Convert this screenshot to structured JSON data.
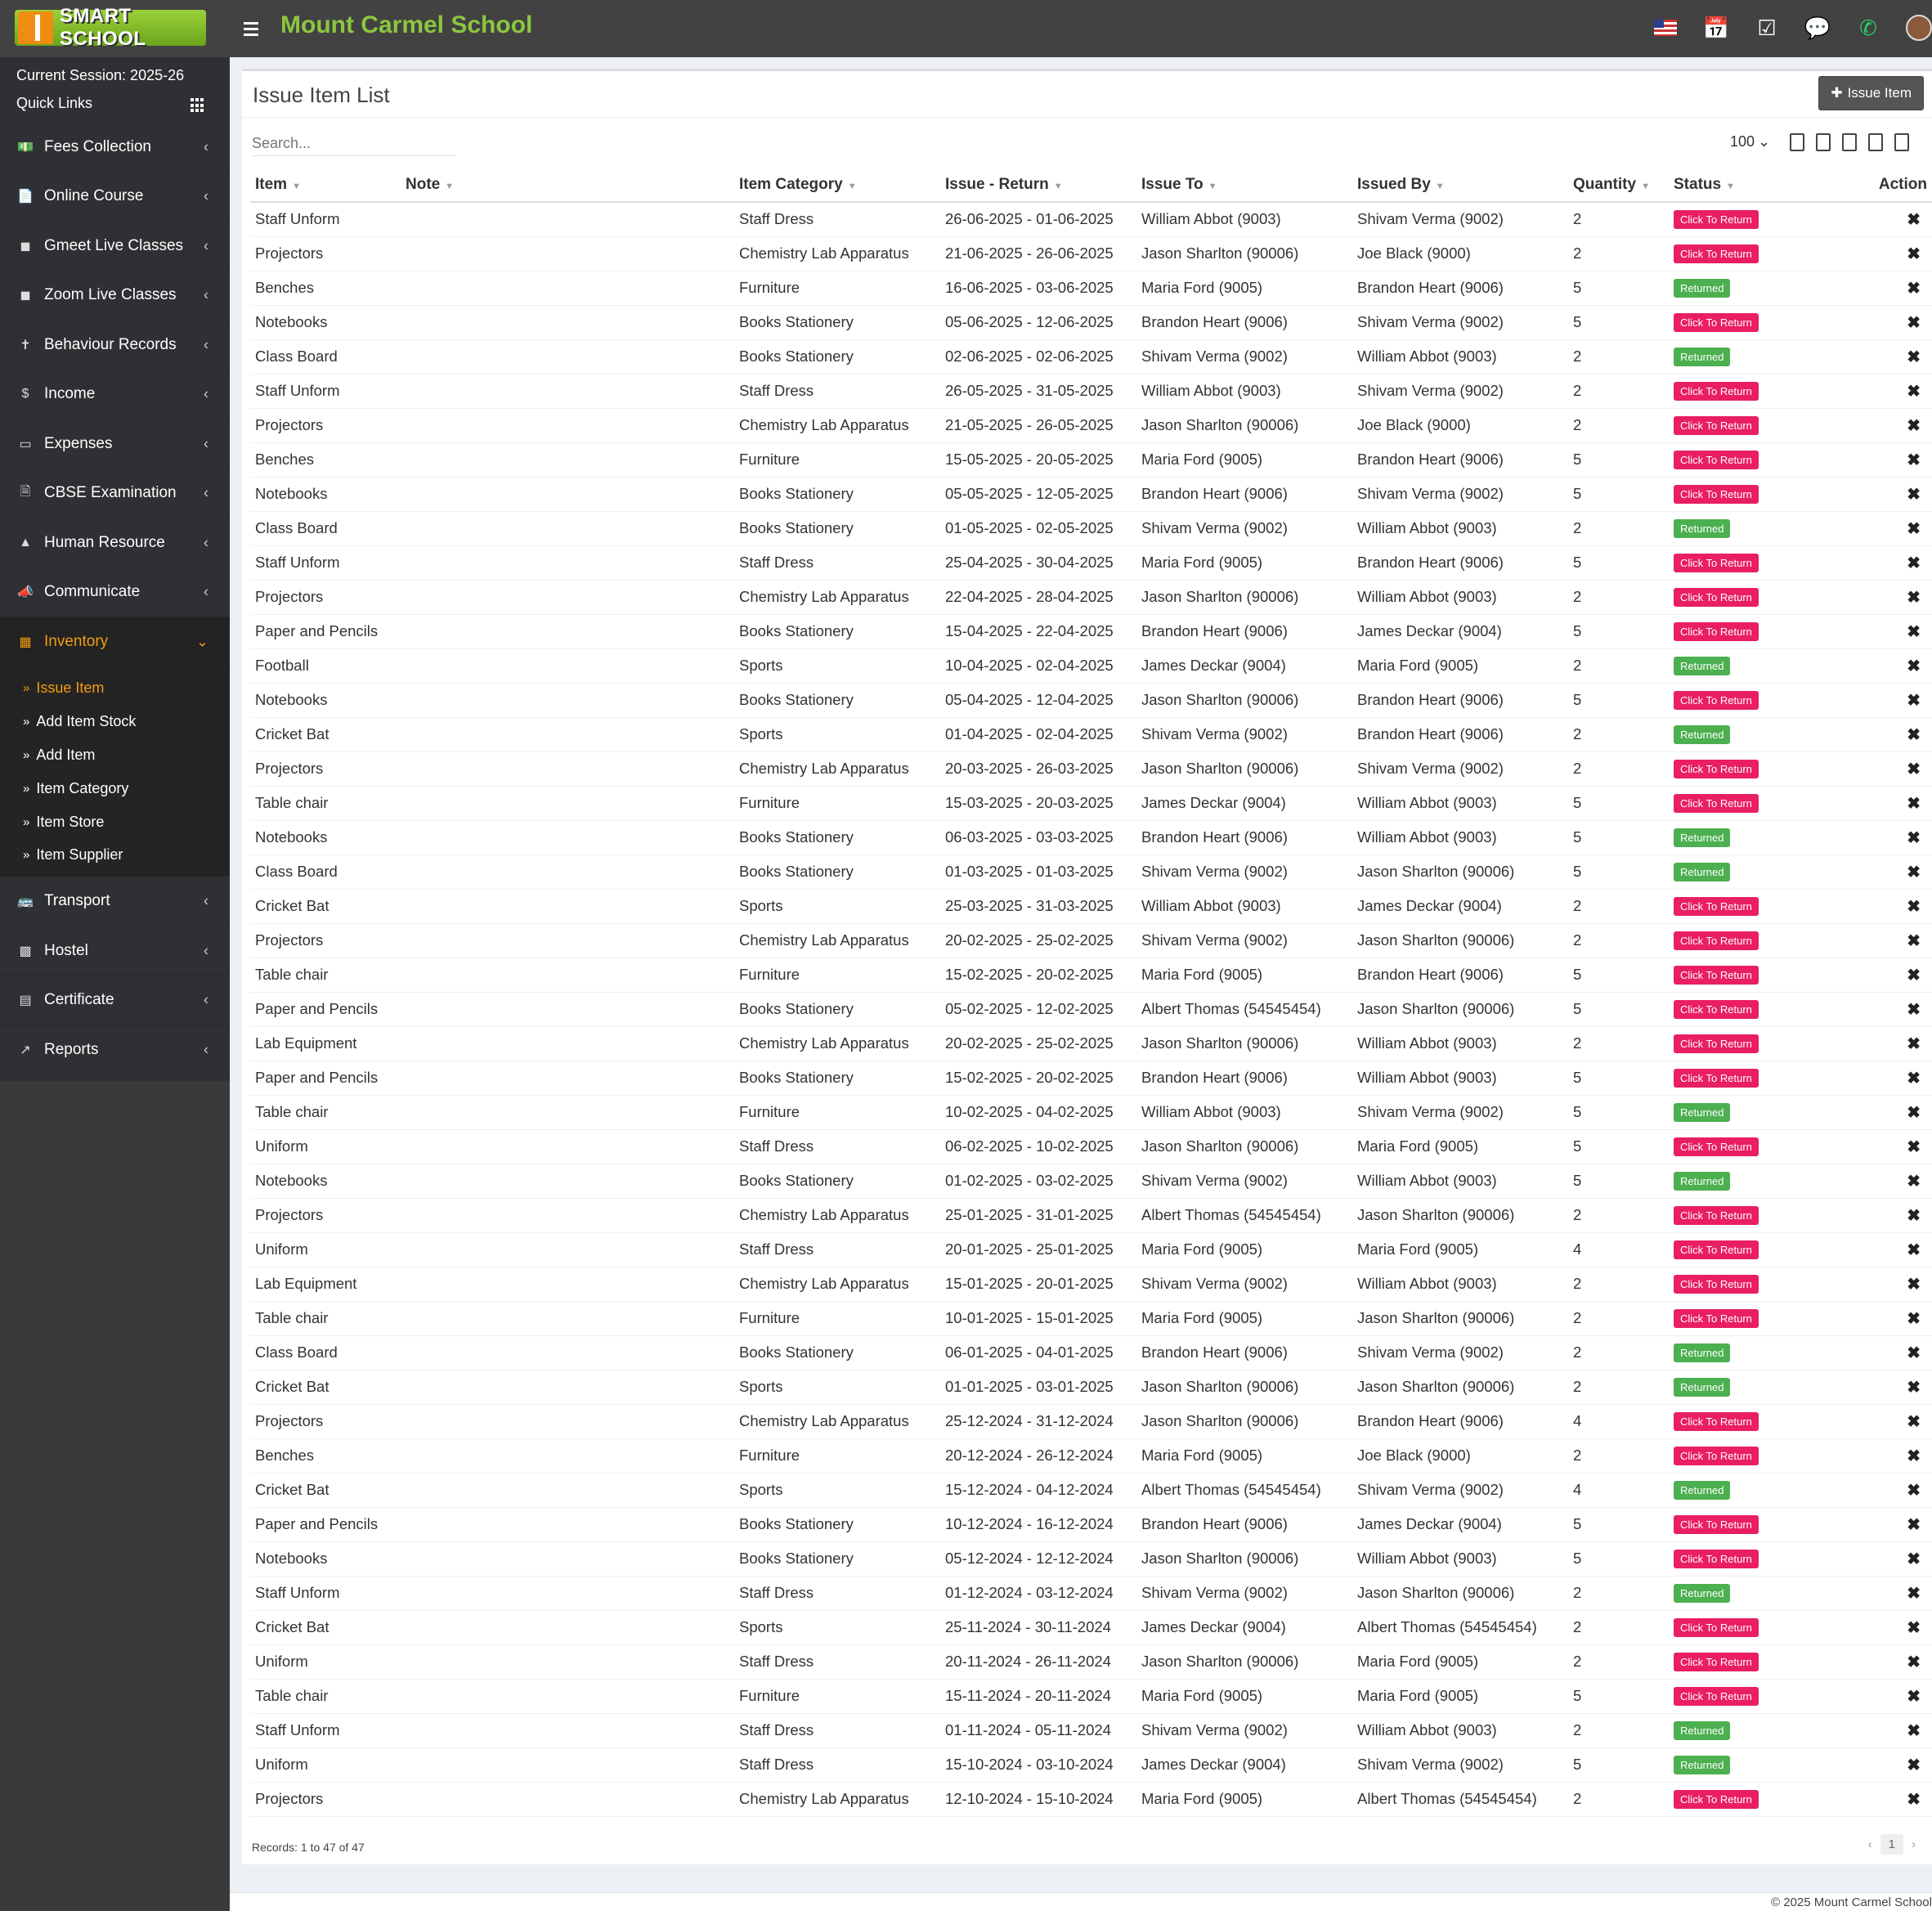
{
  "header": {
    "logo_text": "SMART SCHOOL",
    "school_name": "Mount Carmel School"
  },
  "sidebar": {
    "session": "Current Session: 2025-26",
    "quick_links": "Quick Links",
    "items": [
      {
        "label": "Fees Collection",
        "icon": "money-icon"
      },
      {
        "label": "Online Course",
        "icon": "file-icon"
      },
      {
        "label": "Gmeet Live Classes",
        "icon": "video-icon"
      },
      {
        "label": "Zoom Live Classes",
        "icon": "video-icon"
      },
      {
        "label": "Behaviour Records",
        "icon": "signpost-icon"
      },
      {
        "label": "Income",
        "icon": "dollar-icon"
      },
      {
        "label": "Expenses",
        "icon": "credit-card-icon"
      },
      {
        "label": "CBSE Examination",
        "icon": "document-icon"
      },
      {
        "label": "Human Resource",
        "icon": "sitemap-icon"
      },
      {
        "label": "Communicate",
        "icon": "bullhorn-icon"
      },
      {
        "label": "Inventory",
        "icon": "inventory-icon"
      }
    ],
    "inventory_sub": [
      "Issue Item",
      "Add Item Stock",
      "Add Item",
      "Item Category",
      "Item Store",
      "Item Supplier"
    ],
    "items_after": [
      {
        "label": "Transport",
        "icon": "bus-icon"
      },
      {
        "label": "Hostel",
        "icon": "building-icon"
      },
      {
        "label": "Certificate",
        "icon": "certificate-icon"
      },
      {
        "label": "Reports",
        "icon": "line-chart-icon"
      }
    ]
  },
  "main": {
    "title": "Issue Item List",
    "issue_button": "Issue Item",
    "search_placeholder": "Search...",
    "page_size": "100",
    "columns": [
      "Item",
      "Note",
      "Item Category",
      "Issue - Return",
      "Issue To",
      "Issued By",
      "Quantity",
      "Status",
      "Action"
    ],
    "rows": [
      [
        "Staff Unform",
        "",
        "Staff Dress",
        "26-06-2025 - 01-06-2025",
        "William Abbot (9003)",
        "Shivam Verma (9002)",
        "2",
        "Click To Return"
      ],
      [
        "Projectors",
        "",
        "Chemistry Lab Apparatus",
        "21-06-2025 - 26-06-2025",
        "Jason Sharlton (90006)",
        "Joe Black (9000)",
        "2",
        "Click To Return"
      ],
      [
        "Benches",
        "",
        "Furniture",
        "16-06-2025 - 03-06-2025",
        "Maria Ford (9005)",
        "Brandon Heart (9006)",
        "5",
        "Returned"
      ],
      [
        "Notebooks",
        "",
        "Books Stationery",
        "05-06-2025 - 12-06-2025",
        "Brandon Heart (9006)",
        "Shivam Verma (9002)",
        "5",
        "Click To Return"
      ],
      [
        "Class Board",
        "",
        "Books Stationery",
        "02-06-2025 - 02-06-2025",
        "Shivam Verma (9002)",
        "William Abbot (9003)",
        "2",
        "Returned"
      ],
      [
        "Staff Unform",
        "",
        "Staff Dress",
        "26-05-2025 - 31-05-2025",
        "William Abbot (9003)",
        "Shivam Verma (9002)",
        "2",
        "Click To Return"
      ],
      [
        "Projectors",
        "",
        "Chemistry Lab Apparatus",
        "21-05-2025 - 26-05-2025",
        "Jason Sharlton (90006)",
        "Joe Black (9000)",
        "2",
        "Click To Return"
      ],
      [
        "Benches",
        "",
        "Furniture",
        "15-05-2025 - 20-05-2025",
        "Maria Ford (9005)",
        "Brandon Heart (9006)",
        "5",
        "Click To Return"
      ],
      [
        "Notebooks",
        "",
        "Books Stationery",
        "05-05-2025 - 12-05-2025",
        "Brandon Heart (9006)",
        "Shivam Verma (9002)",
        "5",
        "Click To Return"
      ],
      [
        "Class Board",
        "",
        "Books Stationery",
        "01-05-2025 - 02-05-2025",
        "Shivam Verma (9002)",
        "William Abbot (9003)",
        "2",
        "Returned"
      ],
      [
        "Staff Unform",
        "",
        "Staff Dress",
        "25-04-2025 - 30-04-2025",
        "Maria Ford (9005)",
        "Brandon Heart (9006)",
        "5",
        "Click To Return"
      ],
      [
        "Projectors",
        "",
        "Chemistry Lab Apparatus",
        "22-04-2025 - 28-04-2025",
        "Jason Sharlton (90006)",
        "William Abbot (9003)",
        "2",
        "Click To Return"
      ],
      [
        "Paper and Pencils",
        "",
        "Books Stationery",
        "15-04-2025 - 22-04-2025",
        "Brandon Heart (9006)",
        "James Deckar (9004)",
        "5",
        "Click To Return"
      ],
      [
        "Football",
        "",
        "Sports",
        "10-04-2025 - 02-04-2025",
        "James Deckar (9004)",
        "Maria Ford (9005)",
        "2",
        "Returned"
      ],
      [
        "Notebooks",
        "",
        "Books Stationery",
        "05-04-2025 - 12-04-2025",
        "Jason Sharlton (90006)",
        "Brandon Heart (9006)",
        "5",
        "Click To Return"
      ],
      [
        "Cricket Bat",
        "",
        "Sports",
        "01-04-2025 - 02-04-2025",
        "Shivam Verma (9002)",
        "Brandon Heart (9006)",
        "2",
        "Returned"
      ],
      [
        "Projectors",
        "",
        "Chemistry Lab Apparatus",
        "20-03-2025 - 26-03-2025",
        "Jason Sharlton (90006)",
        "Shivam Verma (9002)",
        "2",
        "Click To Return"
      ],
      [
        "Table chair",
        "",
        "Furniture",
        "15-03-2025 - 20-03-2025",
        "James Deckar (9004)",
        "William Abbot (9003)",
        "5",
        "Click To Return"
      ],
      [
        "Notebooks",
        "",
        "Books Stationery",
        "06-03-2025 - 03-03-2025",
        "Brandon Heart (9006)",
        "William Abbot (9003)",
        "5",
        "Returned"
      ],
      [
        "Class Board",
        "",
        "Books Stationery",
        "01-03-2025 - 01-03-2025",
        "Shivam Verma (9002)",
        "Jason Sharlton (90006)",
        "5",
        "Returned"
      ],
      [
        "Cricket Bat",
        "",
        "Sports",
        "25-03-2025 - 31-03-2025",
        "William Abbot (9003)",
        "James Deckar (9004)",
        "2",
        "Click To Return"
      ],
      [
        "Projectors",
        "",
        "Chemistry Lab Apparatus",
        "20-02-2025 - 25-02-2025",
        "Shivam Verma (9002)",
        "Jason Sharlton (90006)",
        "2",
        "Click To Return"
      ],
      [
        "Table chair",
        "",
        "Furniture",
        "15-02-2025 - 20-02-2025",
        "Maria Ford (9005)",
        "Brandon Heart (9006)",
        "5",
        "Click To Return"
      ],
      [
        "Paper and Pencils",
        "",
        "Books Stationery",
        "05-02-2025 - 12-02-2025",
        "Albert Thomas (54545454)",
        "Jason Sharlton (90006)",
        "5",
        "Click To Return"
      ],
      [
        "Lab Equipment",
        "",
        "Chemistry Lab Apparatus",
        "20-02-2025 - 25-02-2025",
        "Jason Sharlton (90006)",
        "William Abbot (9003)",
        "2",
        "Click To Return"
      ],
      [
        "Paper and Pencils",
        "",
        "Books Stationery",
        "15-02-2025 - 20-02-2025",
        "Brandon Heart (9006)",
        "William Abbot (9003)",
        "5",
        "Click To Return"
      ],
      [
        "Table chair",
        "",
        "Furniture",
        "10-02-2025 - 04-02-2025",
        "William Abbot (9003)",
        "Shivam Verma (9002)",
        "5",
        "Returned"
      ],
      [
        "Uniform",
        "",
        "Staff Dress",
        "06-02-2025 - 10-02-2025",
        "Jason Sharlton (90006)",
        "Maria Ford (9005)",
        "5",
        "Click To Return"
      ],
      [
        "Notebooks",
        "",
        "Books Stationery",
        "01-02-2025 - 03-02-2025",
        "Shivam Verma (9002)",
        "William Abbot (9003)",
        "5",
        "Returned"
      ],
      [
        "Projectors",
        "",
        "Chemistry Lab Apparatus",
        "25-01-2025 - 31-01-2025",
        "Albert Thomas (54545454)",
        "Jason Sharlton (90006)",
        "2",
        "Click To Return"
      ],
      [
        "Uniform",
        "",
        "Staff Dress",
        "20-01-2025 - 25-01-2025",
        "Maria Ford (9005)",
        "Maria Ford (9005)",
        "4",
        "Click To Return"
      ],
      [
        "Lab Equipment",
        "",
        "Chemistry Lab Apparatus",
        "15-01-2025 - 20-01-2025",
        "Shivam Verma (9002)",
        "William Abbot (9003)",
        "2",
        "Click To Return"
      ],
      [
        "Table chair",
        "",
        "Furniture",
        "10-01-2025 - 15-01-2025",
        "Maria Ford (9005)",
        "Jason Sharlton (90006)",
        "2",
        "Click To Return"
      ],
      [
        "Class Board",
        "",
        "Books Stationery",
        "06-01-2025 - 04-01-2025",
        "Brandon Heart (9006)",
        "Shivam Verma (9002)",
        "2",
        "Returned"
      ],
      [
        "Cricket Bat",
        "",
        "Sports",
        "01-01-2025 - 03-01-2025",
        "Jason Sharlton (90006)",
        "Jason Sharlton (90006)",
        "2",
        "Returned"
      ],
      [
        "Projectors",
        "",
        "Chemistry Lab Apparatus",
        "25-12-2024 - 31-12-2024",
        "Jason Sharlton (90006)",
        "Brandon Heart (9006)",
        "4",
        "Click To Return"
      ],
      [
        "Benches",
        "",
        "Furniture",
        "20-12-2024 - 26-12-2024",
        "Maria Ford (9005)",
        "Joe Black (9000)",
        "2",
        "Click To Return"
      ],
      [
        "Cricket Bat",
        "",
        "Sports",
        "15-12-2024 - 04-12-2024",
        "Albert Thomas (54545454)",
        "Shivam Verma (9002)",
        "4",
        "Returned"
      ],
      [
        "Paper and Pencils",
        "",
        "Books Stationery",
        "10-12-2024 - 16-12-2024",
        "Brandon Heart (9006)",
        "James Deckar (9004)",
        "5",
        "Click To Return"
      ],
      [
        "Notebooks",
        "",
        "Books Stationery",
        "05-12-2024 - 12-12-2024",
        "Jason Sharlton (90006)",
        "William Abbot (9003)",
        "5",
        "Click To Return"
      ],
      [
        "Staff Unform",
        "",
        "Staff Dress",
        "01-12-2024 - 03-12-2024",
        "Shivam Verma (9002)",
        "Jason Sharlton (90006)",
        "2",
        "Returned"
      ],
      [
        "Cricket Bat",
        "",
        "Sports",
        "25-11-2024 - 30-11-2024",
        "James Deckar (9004)",
        "Albert Thomas (54545454)",
        "2",
        "Click To Return"
      ],
      [
        "Uniform",
        "",
        "Staff Dress",
        "20-11-2024 - 26-11-2024",
        "Jason Sharlton (90006)",
        "Maria Ford (9005)",
        "2",
        "Click To Return"
      ],
      [
        "Table chair",
        "",
        "Furniture",
        "15-11-2024 - 20-11-2024",
        "Maria Ford (9005)",
        "Maria Ford (9005)",
        "5",
        "Click To Return"
      ],
      [
        "Staff Unform",
        "",
        "Staff Dress",
        "01-11-2024 - 05-11-2024",
        "Shivam Verma (9002)",
        "William Abbot (9003)",
        "2",
        "Returned"
      ],
      [
        "Uniform",
        "",
        "Staff Dress",
        "15-10-2024 - 03-10-2024",
        "James Deckar (9004)",
        "Shivam Verma (9002)",
        "5",
        "Returned"
      ],
      [
        "Projectors",
        "",
        "Chemistry Lab Apparatus",
        "12-10-2024 - 15-10-2024",
        "Maria Ford (9005)",
        "Albert Thomas (54545454)",
        "2",
        "Click To Return"
      ]
    ],
    "records": "Records: 1 to 47 of 47",
    "current_page": "1"
  },
  "footer": {
    "copyright": "© 2025 Mount Carmel School"
  },
  "colors": {
    "returned": "#4caf50",
    "click_to_return": "#e91e63",
    "accent": "#f39c12",
    "school_name": "#8cc63f"
  }
}
